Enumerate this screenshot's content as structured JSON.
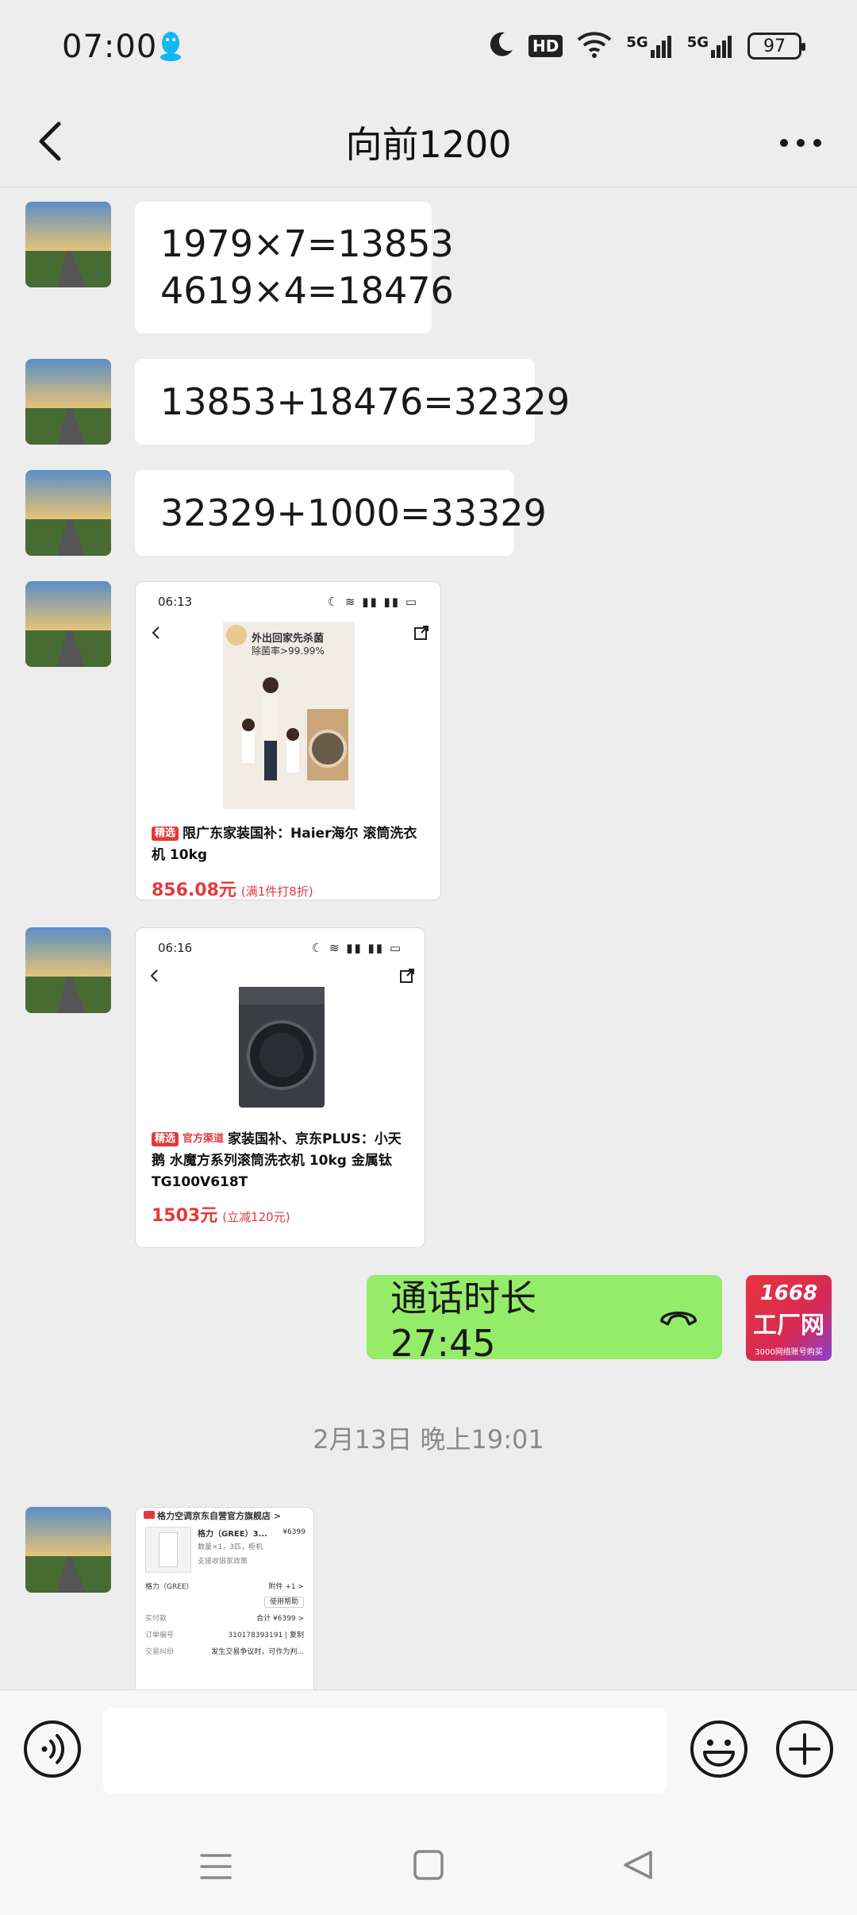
{
  "status_bar": {
    "time": "07:00",
    "hd_label": "HD",
    "net1": "5G",
    "net2": "5G",
    "battery": "97"
  },
  "header": {
    "title": "向前1200"
  },
  "messages": {
    "m1_line1": "1979×7=13853",
    "m1_line2": "4619×4=18476",
    "m2": "13853+18476=32329",
    "m3": "32329+1000=33329",
    "call": "通话时长 27:45",
    "date_separator": "2月13日 晚上19:01"
  },
  "card1": {
    "status_time": "06:13",
    "banner_line1": "外出回家先杀菌",
    "banner_line2": "除菌率>99.99%",
    "tag": "精选",
    "title": "限广东家装国补：Haier海尔 滚筒洗衣机 10kg",
    "price": "856.08元",
    "price_note": "(满1件打8折)"
  },
  "card2": {
    "status_time": "06:16",
    "tag": "精选",
    "tag2": "官方渠道",
    "title": "家装国补、京东PLUS：小天鹅 水魔方系列滚筒洗衣机 10kg 金属钛 TG100V618T",
    "price": "1503元",
    "price_note": "(立减120元)"
  },
  "card3": {
    "shop": "格力空调京东自营官方旗舰店 >",
    "product": "格力（GREE）3...",
    "product_price": "¥6399",
    "qty": "数量×1，3匹，柜机",
    "policy": "支援收银家政策",
    "brand": "格力（GREE）",
    "attach": "附件 +1 >",
    "help": "使用帮助",
    "paid_label": "实付款",
    "paid_value": "合计 ¥6399 >",
    "order_label": "订单编号",
    "order_value": "310178393191",
    "copy": "复制",
    "dispute_label": "交易纠纷",
    "dispute_value": "发生交易争议时，可作为判..."
  },
  "logo": {
    "line1": "1668",
    "line2": "工厂网",
    "line3": "3000网络账号购买"
  },
  "colors": {
    "accent_green": "#95ec69",
    "jd_red": "#e4393c",
    "background": "#ededed"
  }
}
